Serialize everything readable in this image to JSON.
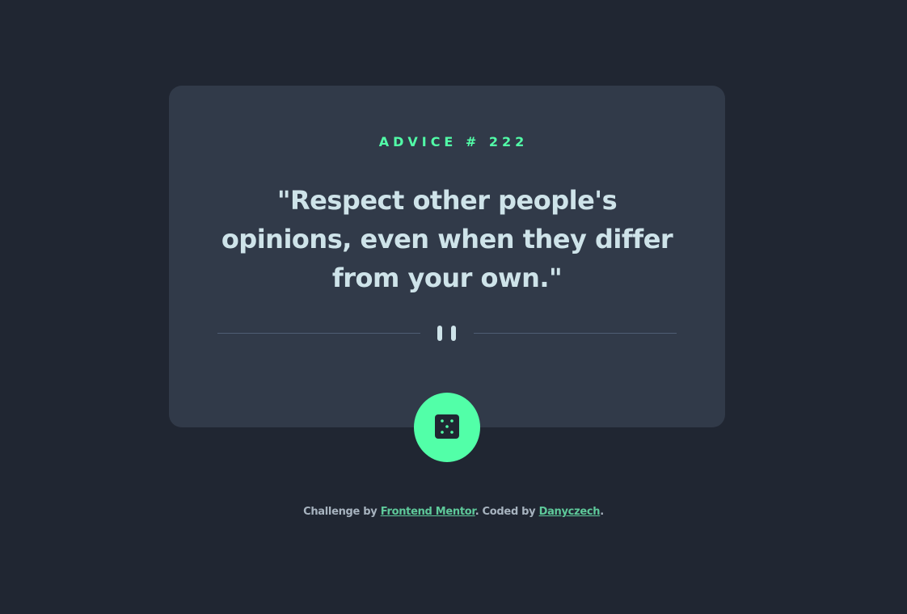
{
  "advice": {
    "id_label": "ADVICE # 222",
    "quote": "\"Respect other people's opinions, even when they differ from your own.\""
  },
  "icons": {
    "divider": "pause-icon",
    "button": "dice-icon"
  },
  "footer": {
    "challenge_prefix": "Challenge by ",
    "challenge_link": "Frontend Mentor",
    "coded_prefix": ". Coded by ",
    "coded_link": "Danyczech",
    "suffix": "."
  },
  "colors": {
    "background": "#202632",
    "card": "#313a49",
    "accent": "#52ffa8",
    "quote_text": "#cee3e9",
    "divider": "#4f5d74",
    "footer_text": "#a7b3bf",
    "footer_link": "#5ec99a"
  }
}
